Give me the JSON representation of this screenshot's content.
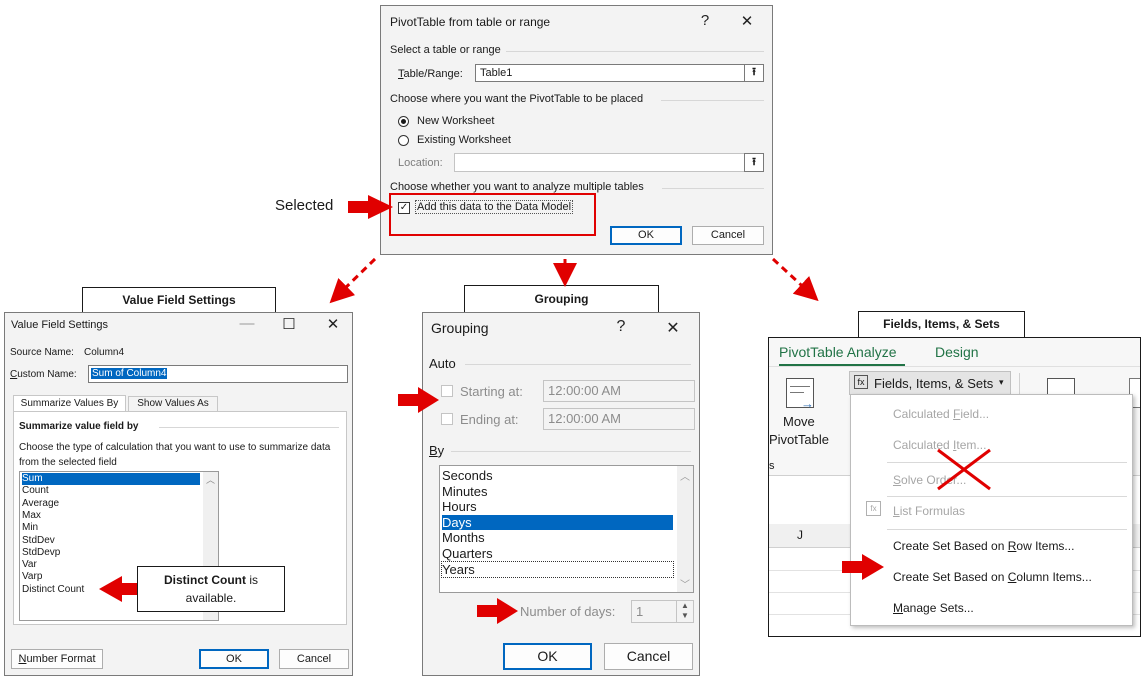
{
  "pivot_dialog": {
    "title": "PivotTable from table or range",
    "help_glyph": "?",
    "close_glyph": "✕",
    "section_select": "Select a table or range",
    "table_range_label": "Table/Range:",
    "table_range_value": "Table1",
    "section_place": "Choose where you want the PivotTable to be placed",
    "radio_new": "New Worksheet",
    "radio_existing": "Existing Worksheet",
    "location_label": "Location:",
    "location_value": "",
    "section_multiple": "Choose whether you want to analyze multiple tables",
    "datamodel_label": "Add this data to the Data Model",
    "datamodel_checked": true,
    "ok_label": "OK",
    "cancel_label": "Cancel",
    "selected_note": "Selected"
  },
  "value_field_settings": {
    "caption": "Value Field Settings",
    "title": "Value Field Settings",
    "min_glyph": "—",
    "max_glyph": "☐",
    "close_glyph": "✕",
    "source_label": "Source Name:",
    "source_value": "Column4",
    "custom_label": "Custom Name:",
    "custom_value": "Sum of Column4",
    "tab_summarize": "Summarize Values By",
    "tab_show": "Show Values As",
    "group_heading": "Summarize value field by",
    "instructions": "Choose the type of calculation that you want to use to summarize data from the selected field",
    "functions": [
      "Sum",
      "Count",
      "Average",
      "Max",
      "Min",
      "StdDev",
      "StdDevp",
      "Var",
      "Varp",
      "Distinct Count"
    ],
    "selected_function": "Sum",
    "number_format_label": "Number Format",
    "ok_label": "OK",
    "cancel_label": "Cancel",
    "callout_bold": "Distinct Count",
    "callout_rest": "is available."
  },
  "grouping": {
    "caption": "Grouping",
    "title": "Grouping",
    "help_glyph": "?",
    "close_glyph": "✕",
    "section_auto": "Auto",
    "starting_label": "Starting at:",
    "starting_value": "12:00:00 AM",
    "ending_label": "Ending at:",
    "ending_value": "12:00:00 AM",
    "section_by": "By",
    "units": [
      "Seconds",
      "Minutes",
      "Hours",
      "Days",
      "Months",
      "Quarters",
      "Years"
    ],
    "selected_unit": "Days",
    "days_label": "Number of days:",
    "days_value": "1",
    "ok_label": "OK",
    "cancel_label": "Cancel"
  },
  "fields_items_sets": {
    "caption": "Fields, Items, & Sets",
    "ribbon_tab_active": "PivotTable Analyze",
    "ribbon_tab_design": "Design",
    "move_line1": "Move",
    "move_line2": "PivotTable",
    "dropdown_label": "Fields, Items, & Sets",
    "column_header": "J",
    "menu": [
      {
        "label": "Calculated Field...",
        "enabled": false
      },
      {
        "label": "Calculated Item...",
        "enabled": false
      },
      {
        "label": "Solve Order...",
        "enabled": false
      },
      {
        "label": "List Formulas",
        "enabled": false
      },
      {
        "label": "Create Set Based on Row Items...",
        "enabled": true
      },
      {
        "label": "Create Set Based on Column Items...",
        "enabled": true
      },
      {
        "label": "Manage Sets...",
        "enabled": true
      }
    ]
  },
  "colors": {
    "arrow_red": "#e00000",
    "selection_blue": "#0067c0",
    "ribbon_green": "#217346"
  }
}
